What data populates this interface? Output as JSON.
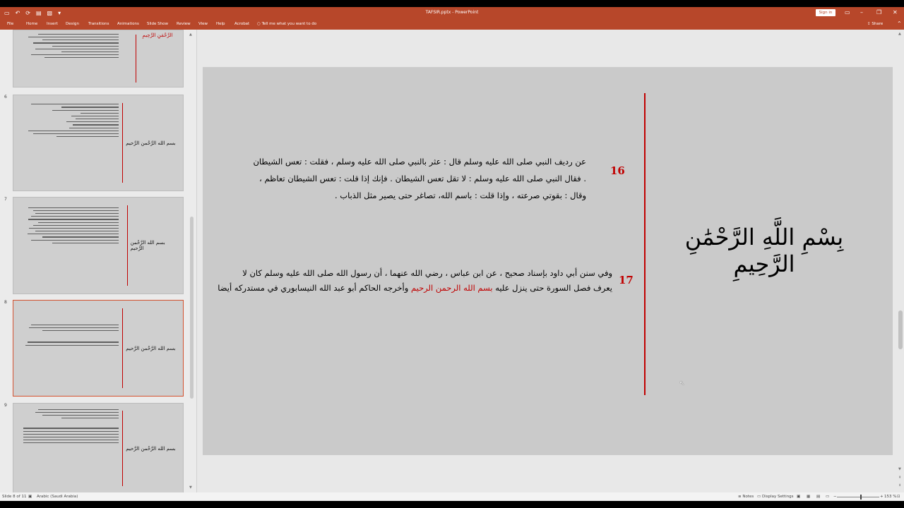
{
  "window": {
    "title": "TAFSIR.pptx - PowerPoint",
    "signin": "Sign in"
  },
  "qat": {
    "autosave": "▭",
    "undo": "↶",
    "redo": "⟳",
    "present": "▤",
    "layout": "▧",
    "more": "▾"
  },
  "menu": {
    "items": [
      "File",
      "Home",
      "Insert",
      "Design",
      "Transitions",
      "Animations",
      "Slide Show",
      "Review",
      "View",
      "Help",
      "Acrobat"
    ],
    "tell": "Tell me what you want to do",
    "share": "Share"
  },
  "thumbnails": {
    "slide5_title": "الرَّحْمَنِ الرَّحِيمِ",
    "bism": "بسم الله الرَّحْمن الرَّحيم",
    "numbers": [
      "6",
      "7",
      "8",
      "9"
    ]
  },
  "slide": {
    "title": "بِسْمِ اللَّهِ الرَّحْمَٰنِ الرَّحِيمِ",
    "n16": "16",
    "n17": "17",
    "p16_l1": "عن رديف النبي صلى الله عليه وسلم قال : عثر بالنبي صلى الله عليه وسلم ، فقلت : تعس الشيطان",
    "p16_l2": ". فقال النبي صلى الله عليه وسلم : لا تقل تعس الشيطان . فإنك إذا قلت : تعس الشيطان تعاظم ،",
    "p16_l3": "وقال : بقوتي صرعته ، وإذا قلت : باسم الله، تصاغر حتى يصير مثل الذباب .",
    "p17_l1": "وفي سنن أبي داود بإسناد صحيح ، عن ابن عباس ، رضي الله عنهما ، أن رسول الله صلى الله عليه وسلم كان لا",
    "p17_l2a": "يعرف فصل السورة حتى ينزل عليه",
    "p17_hl": "بسم الله الرحمن الرحيم",
    "p17_l2b": "وأخرجه الحاكم أبو عبد الله النيسابوري في مستدركه أيضا"
  },
  "status": {
    "slide": "Slide 8 of 11",
    "lang": "Arabic (Saudi Arabia)",
    "notes": "Notes",
    "display": "Display Settings",
    "zoom": "153 %"
  },
  "colors": {
    "accent": "#b7472a",
    "red": "#c00000",
    "slide_bg": "#cacaca"
  }
}
